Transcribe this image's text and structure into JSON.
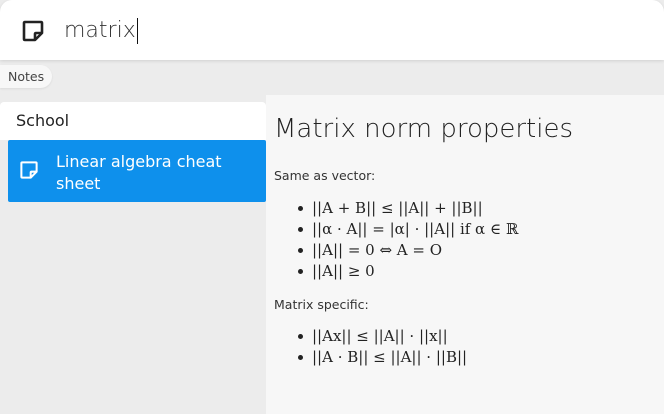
{
  "search": {
    "query": "matrix",
    "icon": "note-icon"
  },
  "category": "Notes",
  "results": {
    "group": "School",
    "items": [
      {
        "title": "Linear algebra cheat sheet",
        "icon": "note-icon",
        "selected": true
      }
    ]
  },
  "preview": {
    "title": "Matrix norm properties",
    "sections": [
      {
        "heading": "Same as vector:",
        "items": [
          "||A + B|| ≤ ||A|| + ||B||",
          "||α · A|| = |α| · ||A|| if α ∈ ℝ",
          "||A|| = 0 ⇔ A = O",
          "||A|| ≥ 0"
        ]
      },
      {
        "heading": "Matrix specific:",
        "items": [
          "||Ax|| ≤ ||A|| · ||x||",
          "||A · B|| ≤ ||A|| · ||B||"
        ]
      }
    ]
  },
  "colors": {
    "accent": "#0e90ec",
    "background": "#ececec",
    "panel": "#ffffff",
    "preview": "#f7f7f7"
  }
}
